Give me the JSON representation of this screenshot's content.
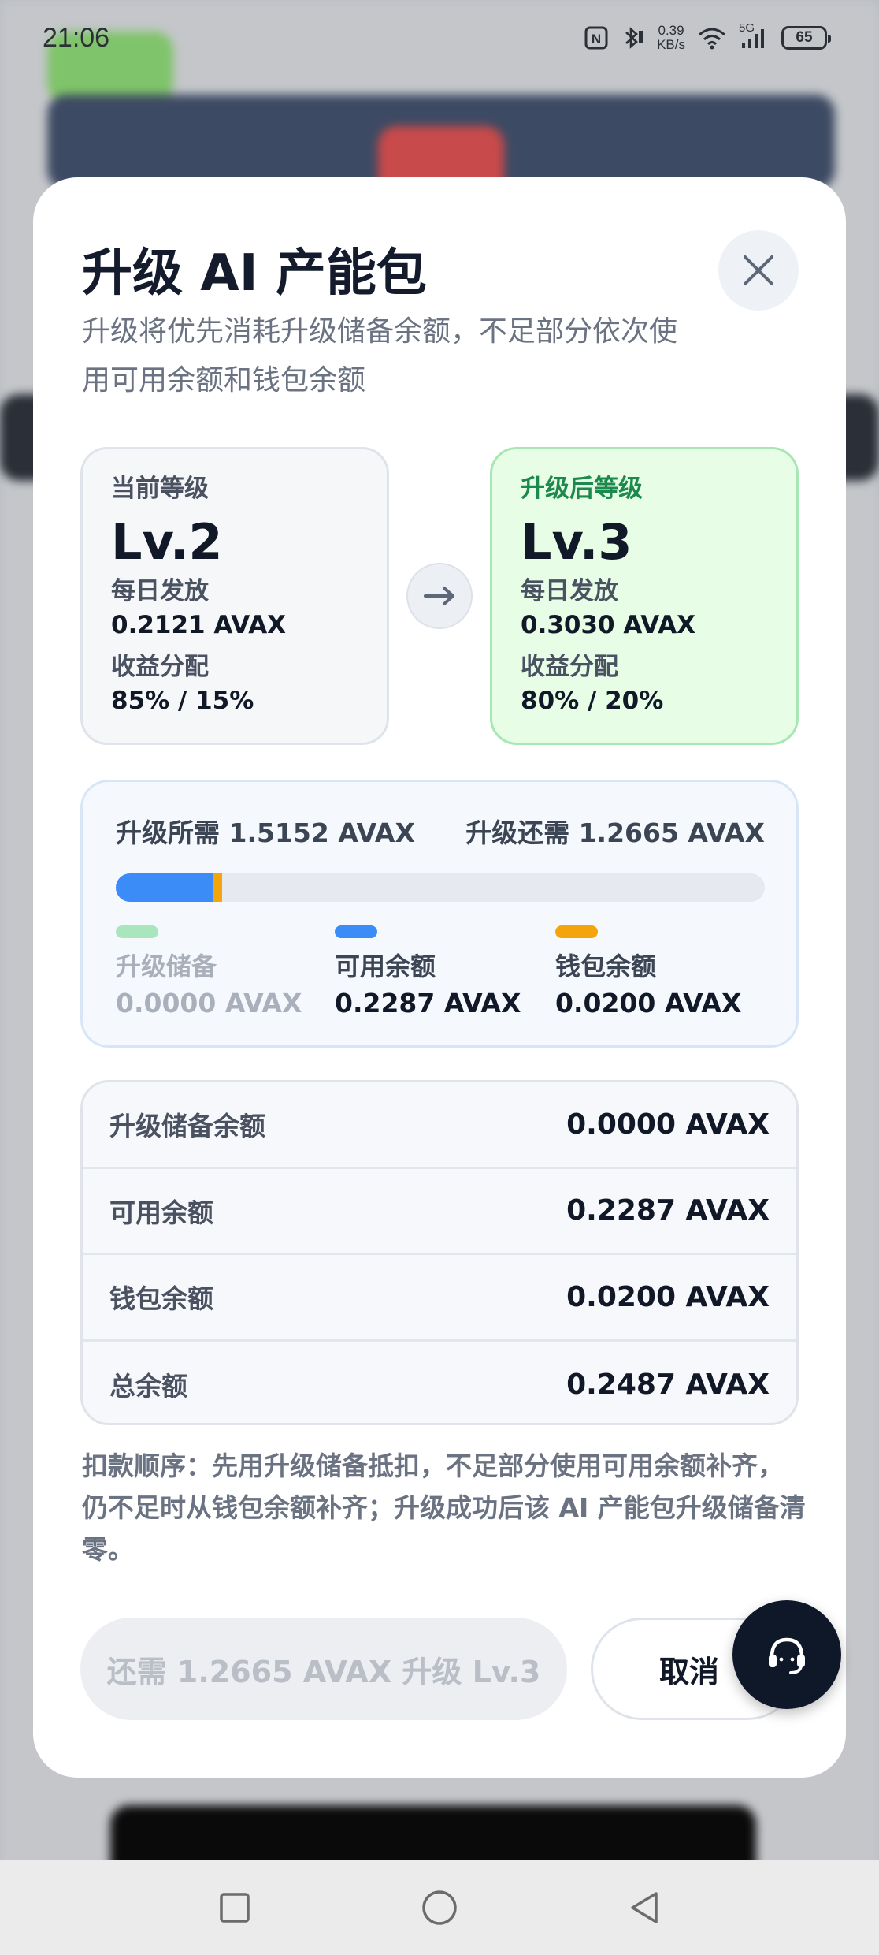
{
  "status_bar": {
    "time": "21:06",
    "net_speed_value": "0.39",
    "net_speed_unit": "KB/s",
    "network_label": "5G",
    "battery": "65",
    "icons": [
      "nfc-icon",
      "bluetooth-icon",
      "wifi-icon",
      "signal-icon",
      "battery-icon"
    ]
  },
  "modal": {
    "title": "升级 AI 产能包",
    "subtitle": "升级将优先消耗升级储备余额，不足部分依次使用可用余额和钱包余额",
    "close_icon": "close-icon"
  },
  "current_level": {
    "label": "当前等级",
    "level": "Lv.2",
    "daily_label": "每日发放",
    "daily_value": "0.2121 AVAX",
    "split_label": "收益分配",
    "split_value": "85% / 15%"
  },
  "upgraded_level": {
    "label": "升级后等级",
    "level": "Lv.3",
    "daily_label": "每日发放",
    "daily_value": "0.3030 AVAX",
    "split_label": "收益分配",
    "split_value": "80% / 20%"
  },
  "progress": {
    "required": "升级所需 1.5152 AVAX",
    "remaining": "升级还需 1.2665 AVAX",
    "segments": [
      {
        "name": "升级储备",
        "fraction": 0.0,
        "color": "#a9e6bd"
      },
      {
        "name": "可用余额",
        "fraction": 0.151,
        "color": "#3b8cf7"
      },
      {
        "name": "钱包余额",
        "fraction": 0.013,
        "color": "#f5a50c"
      }
    ],
    "legend": [
      {
        "label": "升级储备",
        "value": "0.0000 AVAX",
        "color": "#a9e6bd"
      },
      {
        "label": "可用余额",
        "value": "0.2287 AVAX",
        "color": "#3b8cf7"
      },
      {
        "label": "钱包余额",
        "value": "0.0200 AVAX",
        "color": "#f5a50c"
      }
    ]
  },
  "balances": [
    {
      "label": "升级储备余额",
      "value": "0.0000 AVAX"
    },
    {
      "label": "可用余额",
      "value": "0.2287 AVAX"
    },
    {
      "label": "钱包余额",
      "value": "0.0200 AVAX"
    },
    {
      "label": "总余额",
      "value": "0.2487 AVAX"
    }
  ],
  "note": "扣款顺序：先用升级储备抵扣，不足部分使用可用余额补齐，仍不足时从钱包余额补齐；升级成功后该 AI 产能包升级储备清零。",
  "actions": {
    "upgrade_label": "还需 1.2665 AVAX 升级 Lv.3",
    "cancel_label": "取消"
  },
  "support": {
    "icon": "headset-icon"
  },
  "nav_bar": {
    "icons": [
      "recent-apps-icon",
      "home-icon",
      "back-icon"
    ]
  }
}
